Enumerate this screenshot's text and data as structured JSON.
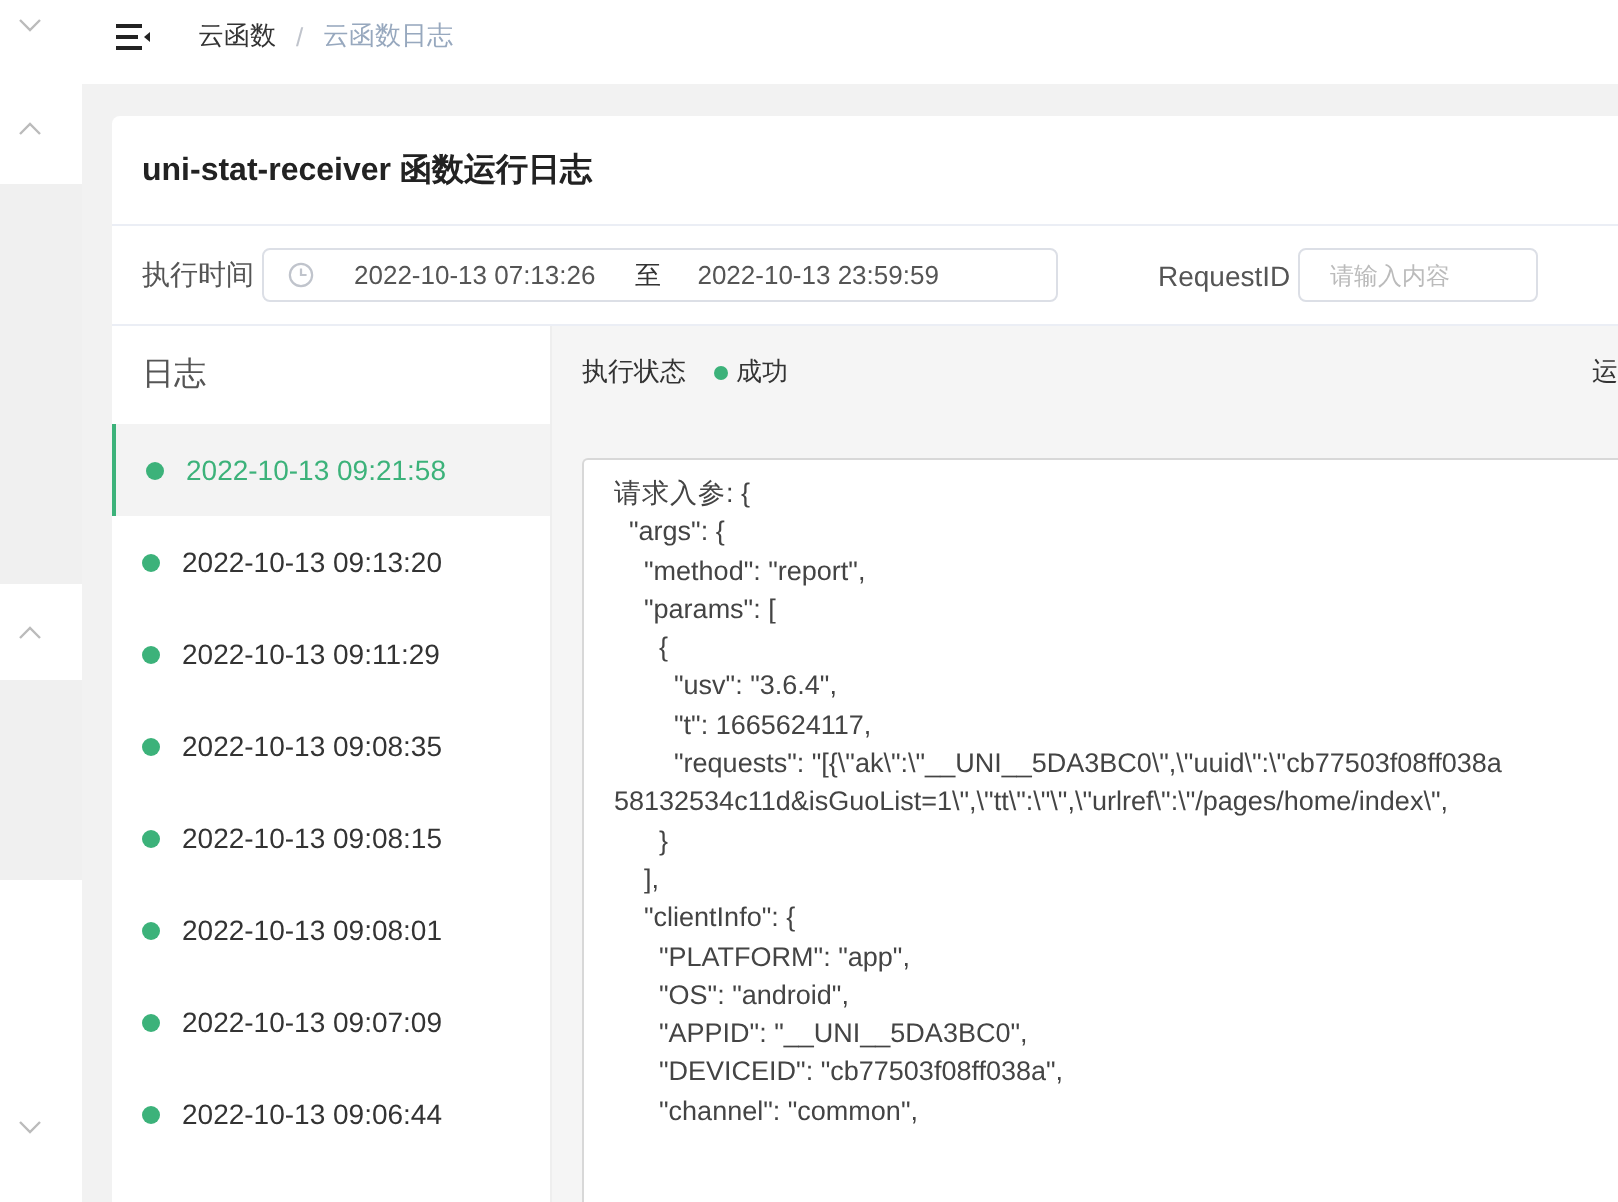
{
  "sidebar_toggles": [
    {
      "expanded": false
    },
    {
      "expanded": true
    },
    {
      "expanded": true
    },
    {
      "expanded": false
    }
  ],
  "breadcrumb": [
    "云函数",
    "云函数日志"
  ],
  "breadcrumb_separator": "/",
  "card": {
    "title": "uni-stat-receiver 函数运行日志"
  },
  "filters": {
    "time_label": "执行时间",
    "start": "2022-10-13 07:13:26",
    "separator": "至",
    "end": "2022-10-13 23:59:59",
    "request_label": "RequestID",
    "request_placeholder": "请输入内容"
  },
  "log_list": {
    "title": "日志",
    "items": [
      {
        "time": "2022-10-13 09:21:58",
        "selected": true
      },
      {
        "time": "2022-10-13 09:13:20",
        "selected": false
      },
      {
        "time": "2022-10-13 09:11:29",
        "selected": false
      },
      {
        "time": "2022-10-13 09:08:35",
        "selected": false
      },
      {
        "time": "2022-10-13 09:08:15",
        "selected": false
      },
      {
        "time": "2022-10-13 09:08:01",
        "selected": false
      },
      {
        "time": "2022-10-13 09:07:09",
        "selected": false
      },
      {
        "time": "2022-10-13 09:06:44",
        "selected": false
      }
    ]
  },
  "detail": {
    "status_label": "执行状态",
    "status": "成功",
    "column_3": "运",
    "code_lines": [
      "请求入参: {",
      "  \"args\": {",
      "    \"method\": \"report\",",
      "    \"params\": [",
      "      {",
      "        \"usv\": \"3.6.4\",",
      "        \"t\": 1665624117,",
      "        \"requests\": \"[{\\\"ak\\\":\\\"__UNI__5DA3BC0\\\",\\\"uuid\\\":\\\"cb77503f08ff038a",
      "58132534c11d&isGuoList=1\\\",\\\"tt\\\":\\\"\\\",\\\"urlref\\\":\\\"/pages/home/index\\\",",
      "      }",
      "    ],",
      "    \"clientInfo\": {",
      "      \"PLATFORM\": \"app\",",
      "      \"OS\": \"android\",",
      "      \"APPID\": \"__UNI__5DA3BC0\",",
      "      \"DEVICEID\": \"cb77503f08ff038a\",",
      "      \"channel\": \"common\","
    ]
  }
}
